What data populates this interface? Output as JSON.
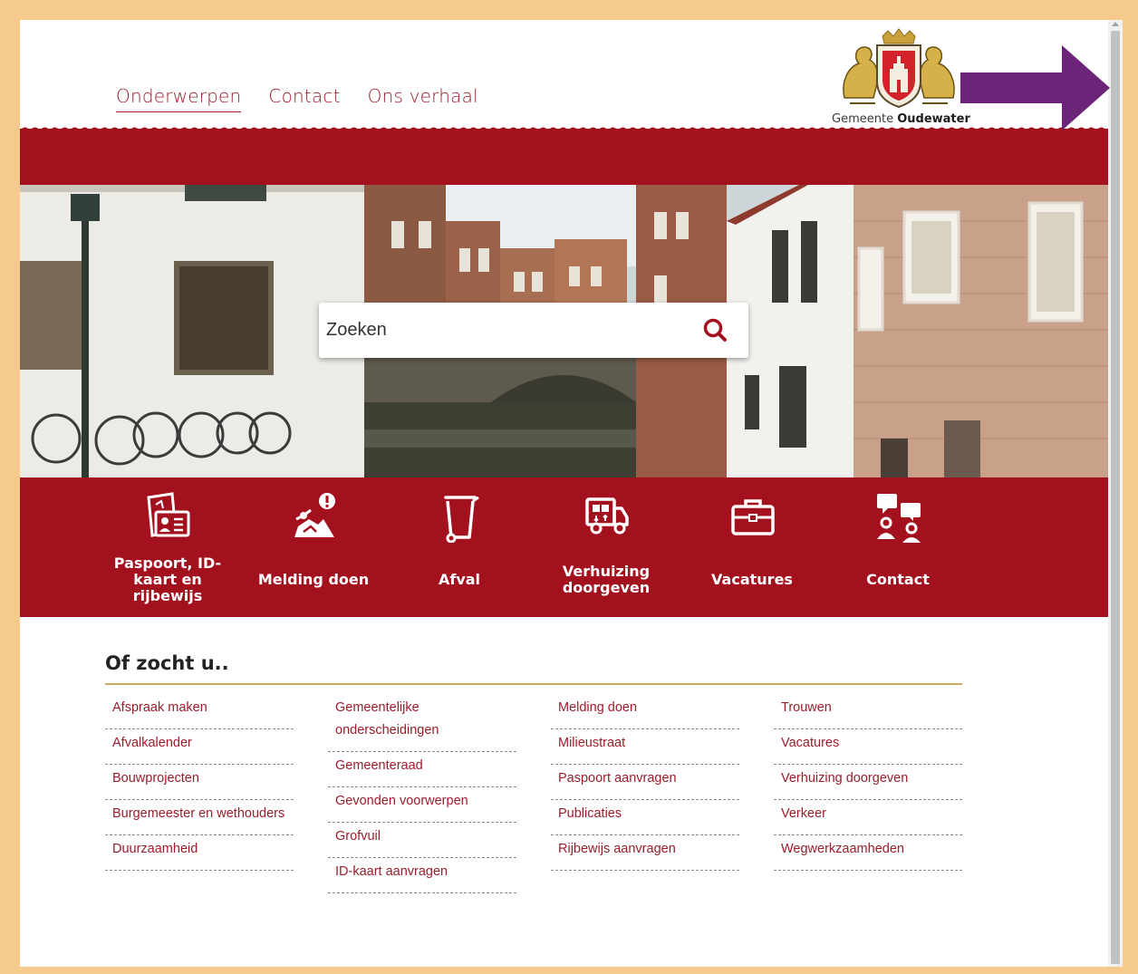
{
  "nav": {
    "items": [
      "Onderwerpen",
      "Contact",
      "Ons verhaal"
    ]
  },
  "logo": {
    "prefix": "Gemeente",
    "name": "Oudewater"
  },
  "search": {
    "placeholder": "Zoeken"
  },
  "tiles": [
    {
      "label": "Paspoort, ID-kaart en rijbewijs",
      "icon": "id-card-icon"
    },
    {
      "label": "Melding doen",
      "icon": "report-icon"
    },
    {
      "label": "Afval",
      "icon": "bin-icon"
    },
    {
      "label": "Verhuizing doorgeven",
      "icon": "moving-truck-icon"
    },
    {
      "label": "Vacatures",
      "icon": "briefcase-icon"
    },
    {
      "label": "Contact",
      "icon": "chat-people-icon"
    }
  ],
  "suggestions": {
    "title": "Of zocht u..",
    "columns": [
      [
        "Afspraak maken",
        "Afvalkalender",
        "Bouwprojecten",
        "Burgemeester en wethouders",
        "Duurzaamheid"
      ],
      [
        "Gemeentelijke onderscheidingen",
        "Gemeenteraad",
        "Gevonden voorwerpen",
        "Grofvuil",
        "ID-kaart aanvragen"
      ],
      [
        "Melding doen",
        "Milieustraat",
        "Paspoort aanvragen",
        "Publicaties",
        "Rijbewijs aanvragen"
      ],
      [
        "Trouwen",
        "Vacatures",
        "Verhuizing doorgeven",
        "Verkeer",
        "Wegwerkzaamheden"
      ]
    ]
  },
  "colors": {
    "brand_red": "#a3111f",
    "link_red": "#9c1c2a",
    "gold_line": "#c9a96a",
    "annotation_arrow": "#6b2478"
  }
}
